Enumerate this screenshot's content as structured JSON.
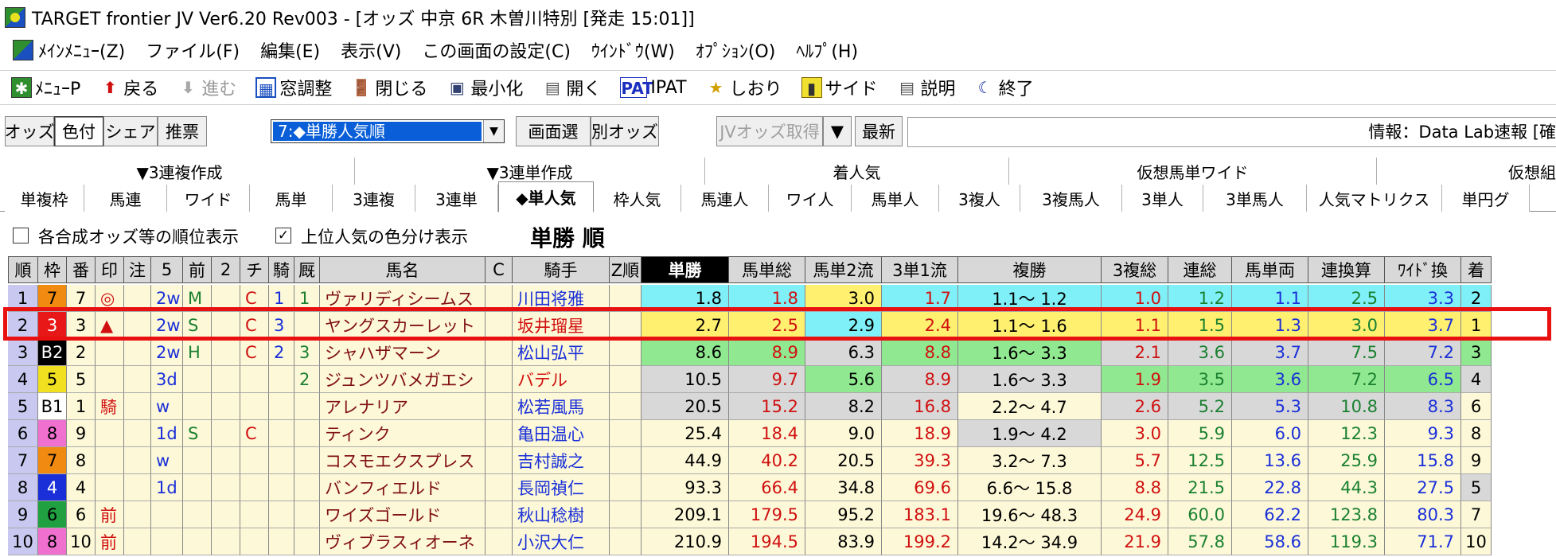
{
  "window": {
    "title": "TARGET frontier JV  Ver6.20  Rev003 - [オッズ 中京 6R 木曽川特別  [発走 15:01]]"
  },
  "menu": {
    "items": [
      "ﾒｲﾝﾒﾆｭｰ(Z)",
      "ファイル(F)",
      "編集(E)",
      "表示(V)",
      "この画面の設定(C)",
      "ｳｲﾝﾄﾞｳ(W)",
      "ｵﾌﾟｼｮﾝ(O)",
      "ﾍﾙﾌﾟ(H)"
    ]
  },
  "toolbar": {
    "menu_p": "ﾒﾆｭｰP",
    "back": "戻る",
    "forward": "進む",
    "window_adjust": "窓調整",
    "close": "閉じる",
    "minimize": "最小化",
    "open": "開く",
    "pat_icon": "PAT",
    "ipat": "IPAT",
    "bookmark": "しおり",
    "side": "サイド",
    "help": "説明",
    "exit": "終了"
  },
  "optbar": {
    "odds": "オッズ",
    "color": "色付",
    "share": "シェア",
    "recommend": "推票",
    "sort_value": "7:◆単勝人気順",
    "screen_select": "画面選",
    "other_odds": "別オッズ",
    "jv_get": "JVオッズ取得",
    "latest": "最新",
    "info": "情報：Data Lab速報 [確"
  },
  "groups": [
    "▼3連複作成",
    "▼3連単作成",
    "着人気",
    "仮想馬単ワイド",
    "仮想組"
  ],
  "tabs": [
    "単複枠",
    "馬連",
    "ワイド",
    "馬単",
    "3連複",
    "3連単",
    "◆単人気",
    "枠人気",
    "馬連人",
    "ワイ人",
    "馬単人",
    "3複人",
    "3複馬人",
    "3単人",
    "3単馬人",
    "人気マトリクス",
    "単円グ"
  ],
  "options": {
    "chk1_label": "各合成オッズ等の順位表示",
    "chk2_label": "上位人気の色分け表示",
    "chk1_mark": "",
    "chk2_mark": "✓",
    "view_title": "単勝 順"
  },
  "columns": [
    "順",
    "枠",
    "番",
    "印",
    "注",
    "5",
    "前",
    "2",
    "チ",
    "騎",
    "厩",
    "馬名",
    "C",
    "騎手",
    "Z順",
    "単勝",
    "馬単総",
    "馬単2流",
    "3単1流",
    "複勝",
    "3複総",
    "連総",
    "馬単両",
    "連換算",
    "ﾜｲﾄﾞ換",
    "着"
  ],
  "rows": [
    [
      "1",
      "7",
      "7",
      "◎",
      "",
      "2w",
      "M",
      "",
      "C",
      "1",
      "1",
      "ヴァリディシームス",
      "",
      "川田将雅",
      "",
      "1.8",
      "1.8",
      "3.0",
      "1.7",
      "1.1〜  1.2",
      "1.0",
      "1.2",
      "1.1",
      "2.5",
      "3.3",
      "2"
    ],
    [
      "2",
      "3",
      "3",
      "▲",
      "",
      "2w",
      "S",
      "",
      "C",
      "3",
      "",
      "ヤングスカーレット",
      "",
      "坂井瑠星",
      "",
      "2.7",
      "2.5",
      "2.9",
      "2.4",
      "1.1〜  1.6",
      "1.1",
      "1.5",
      "1.3",
      "3.0",
      "3.7",
      "1"
    ],
    [
      "3",
      "B2",
      "2",
      "",
      "",
      "2w",
      "H",
      "",
      "C",
      "2",
      "3",
      "シャハザマーン",
      "",
      "松山弘平",
      "",
      "8.6",
      "8.9",
      "6.3",
      "8.8",
      "1.6〜  3.3",
      "2.1",
      "3.6",
      "3.7",
      "7.5",
      "7.2",
      "3"
    ],
    [
      "4",
      "5",
      "5",
      "",
      "",
      "3d",
      "",
      "",
      "",
      "",
      "2",
      "ジュンツバメガエシ",
      "",
      "バデル",
      "",
      "10.5",
      "9.7",
      "5.6",
      "8.9",
      "1.6〜  3.3",
      "1.9",
      "3.5",
      "3.6",
      "7.2",
      "6.5",
      "4"
    ],
    [
      "5",
      "B1",
      "1",
      "騎",
      "",
      "w",
      "",
      "",
      "",
      "",
      "",
      "アレナリア",
      "",
      "松若風馬",
      "",
      "20.5",
      "15.2",
      "8.2",
      "16.8",
      "2.2〜  4.7",
      "2.6",
      "5.2",
      "5.3",
      "10.8",
      "8.3",
      "6"
    ],
    [
      "6",
      "8",
      "9",
      "",
      "",
      "1d",
      "S",
      "",
      "C",
      "",
      "",
      "ティンク",
      "",
      "亀田温心",
      "",
      "25.4",
      "18.4",
      "9.0",
      "18.9",
      "1.9〜  4.2",
      "3.0",
      "5.9",
      "6.0",
      "12.3",
      "9.3",
      "8"
    ],
    [
      "7",
      "7",
      "8",
      "",
      "",
      "w",
      "",
      "",
      "",
      "",
      "",
      "コスモエクスプレス",
      "",
      "吉村誠之",
      "",
      "44.9",
      "40.2",
      "20.5",
      "39.3",
      "3.2〜  7.3",
      "5.7",
      "12.5",
      "13.6",
      "25.9",
      "15.8",
      "9"
    ],
    [
      "8",
      "4",
      "4",
      "",
      "",
      "1d",
      "",
      "",
      "",
      "",
      "",
      "バンフィエルド",
      "",
      "長岡禎仁",
      "",
      "93.3",
      "66.4",
      "34.8",
      "69.6",
      "6.6〜 15.8",
      "8.8",
      "21.5",
      "22.8",
      "44.3",
      "27.5",
      "5"
    ],
    [
      "9",
      "6",
      "6",
      "前",
      "",
      "",
      "",
      "",
      "",
      "",
      "",
      "ワイズゴールド",
      "",
      "秋山稔樹",
      "",
      "209.1",
      "179.5",
      "95.2",
      "183.1",
      "19.6〜 48.3",
      "24.9",
      "60.0",
      "62.2",
      "123.8",
      "80.3",
      "7"
    ],
    [
      "10",
      "8",
      "10",
      "前",
      "",
      "",
      "",
      "",
      "",
      "",
      "",
      "ヴィブラスィオーネ",
      "",
      "小沢大仁",
      "",
      "210.9",
      "194.5",
      "83.9",
      "199.2",
      "14.2〜 34.9",
      "21.9",
      "57.8",
      "58.6",
      "119.3",
      "71.7",
      "10"
    ]
  ],
  "colors": {
    "row_bg": "#fdf9d8",
    "waku_1": "#ffffff",
    "waku_2": "#000000",
    "waku_3": "#e81818",
    "waku_4": "#1a2fd8",
    "waku_5": "#f0e020",
    "waku_6": "#20a040",
    "waku_7": "#f08a10",
    "waku_8": "#f070d0",
    "rank_1": "#7ff0f8",
    "rank_2": "#fff070",
    "rank_3": "#90e890",
    "rank_4": "#d8d8d8",
    "highlight": "#e81010"
  }
}
